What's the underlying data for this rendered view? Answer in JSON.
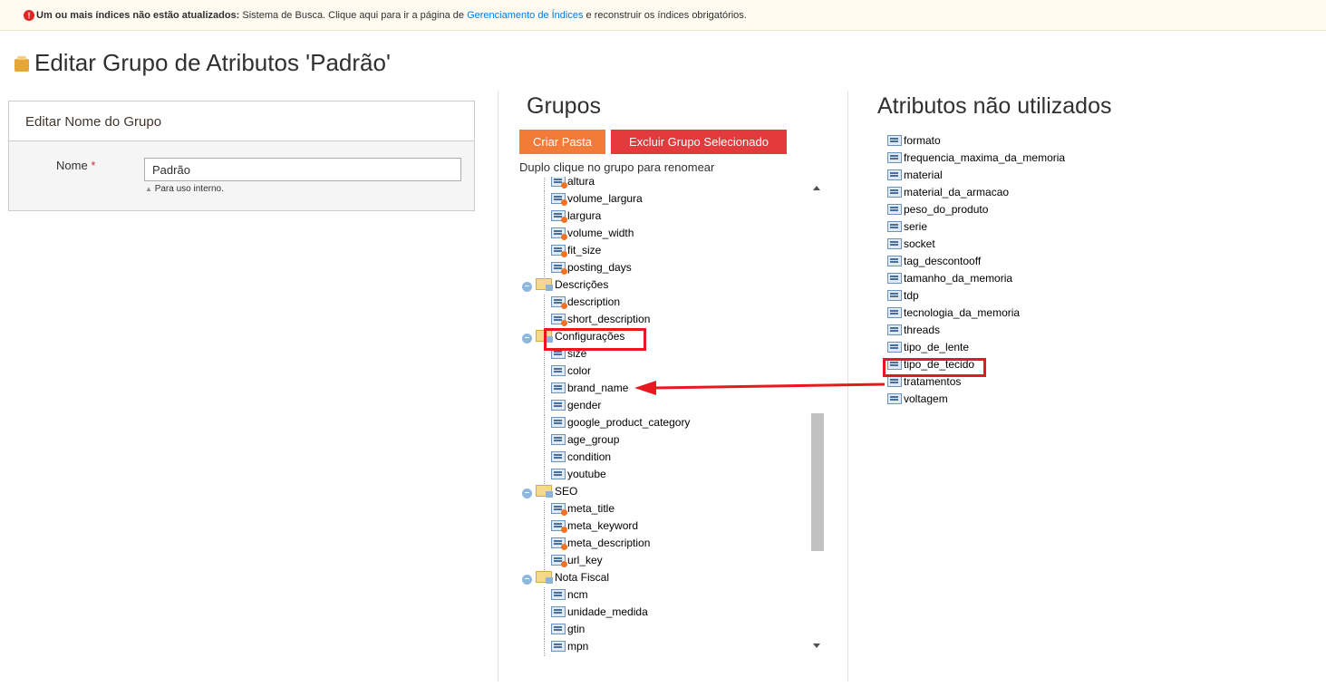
{
  "notice": {
    "lead": "Um ou mais índices não estão atualizados:",
    "text1": " Sistema de Busca. Clique aqui para ir a página de ",
    "link": "Gerenciamento de Índices",
    "text2": " e reconstruir os índices obrigatórios."
  },
  "page_title": "Editar Grupo de Atributos 'Padrão'",
  "edit_panel": {
    "header": "Editar Nome do Grupo",
    "name_label": "Nome",
    "required_mark": "*",
    "name_value": "Padrão",
    "note": "Para uso interno."
  },
  "groups": {
    "title": "Grupos",
    "create_folder_label": "Criar Pasta",
    "delete_group_label": "Excluir Grupo Selecionado",
    "hint": "Duplo clique no grupo para renomear",
    "tree": [
      {
        "label": "altura",
        "kind": "sys"
      },
      {
        "label": "volume_largura",
        "kind": "sys"
      },
      {
        "label": "largura",
        "kind": "sys"
      },
      {
        "label": "volume_width",
        "kind": "sys"
      },
      {
        "label": "fit_size",
        "kind": "sys"
      },
      {
        "label": "posting_days",
        "kind": "sys"
      },
      {
        "label": "Descrições",
        "kind": "folder"
      },
      {
        "label": "description",
        "kind": "sys"
      },
      {
        "label": "short_description",
        "kind": "sys"
      },
      {
        "label": "Configurações",
        "kind": "folder"
      },
      {
        "label": "size",
        "kind": "attr"
      },
      {
        "label": "color",
        "kind": "attr"
      },
      {
        "label": "brand_name",
        "kind": "attr"
      },
      {
        "label": "gender",
        "kind": "attr"
      },
      {
        "label": "google_product_category",
        "kind": "attr"
      },
      {
        "label": "age_group",
        "kind": "attr"
      },
      {
        "label": "condition",
        "kind": "attr"
      },
      {
        "label": "youtube",
        "kind": "attr"
      },
      {
        "label": "SEO",
        "kind": "folder"
      },
      {
        "label": "meta_title",
        "kind": "sys"
      },
      {
        "label": "meta_keyword",
        "kind": "sys"
      },
      {
        "label": "meta_description",
        "kind": "sys"
      },
      {
        "label": "url_key",
        "kind": "sys"
      },
      {
        "label": "Nota Fiscal",
        "kind": "folder"
      },
      {
        "label": "ncm",
        "kind": "attr"
      },
      {
        "label": "unidade_medida",
        "kind": "attr"
      },
      {
        "label": "gtin",
        "kind": "attr"
      },
      {
        "label": "mpn",
        "kind": "attr"
      }
    ]
  },
  "unused": {
    "title": "Atributos não utilizados",
    "items": [
      "formato",
      "frequencia_maxima_da_memoria",
      "material",
      "material_da_armacao",
      "peso_do_produto",
      "serie",
      "socket",
      "tag_descontooff",
      "tamanho_da_memoria",
      "tdp",
      "tecnologia_da_memoria",
      "threads",
      "tipo_de_lente",
      "tipo_de_tecido",
      "tratamentos",
      "voltagem"
    ]
  },
  "colors": {
    "accent_orange": "#f27b3a",
    "accent_red": "#e33a3d",
    "highlight": "#e8191e",
    "link": "#007bdb"
  }
}
